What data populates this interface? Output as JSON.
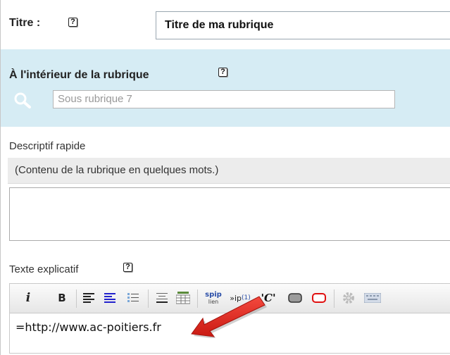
{
  "title_section": {
    "label": "Titre :",
    "help": "?",
    "value": "Titre de ma rubrique"
  },
  "rubrique_section": {
    "label": "À l'intérieur de la rubrique",
    "help": "?",
    "placeholder": "Sous rubrique 7"
  },
  "descriptif_section": {
    "label": "Descriptif rapide",
    "hint": "(Contenu de la rubrique en quelques mots.)",
    "value": ""
  },
  "texte_section": {
    "label": "Texte explicatif",
    "help": "?",
    "toolbar": {
      "italic": "i",
      "bold": "B",
      "spip_top": "spip",
      "spip_bottom": "lien",
      "note": "»ip",
      "note_sup": "(1)",
      "quote": "'C'"
    },
    "content": "=http://www.ac-poitiers.fr"
  },
  "colors": {
    "section_blue": "#d6ecf4",
    "arrow_red": "#e3241b",
    "hint_gray": "#ececec"
  }
}
